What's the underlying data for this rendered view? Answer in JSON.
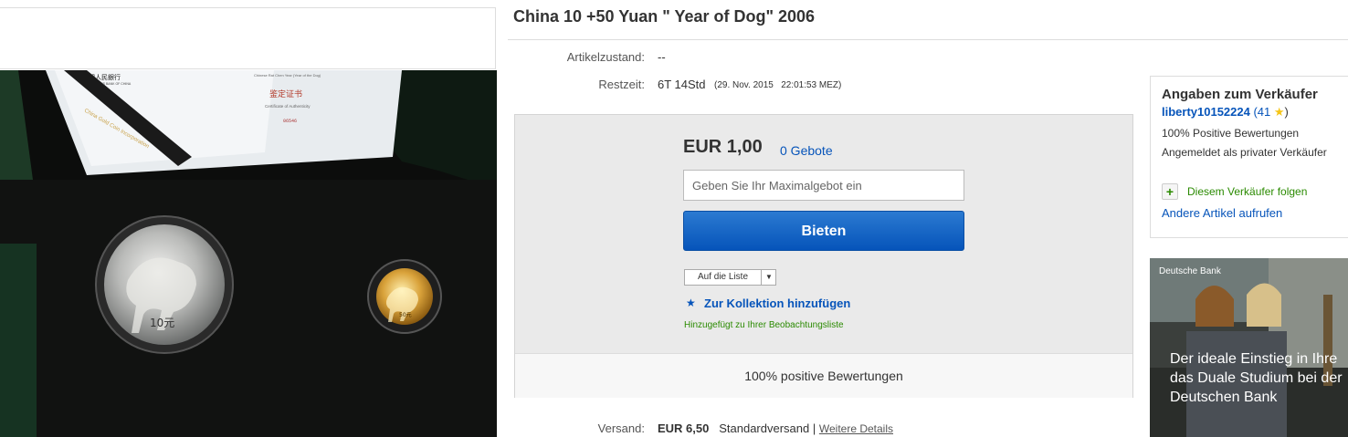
{
  "listing": {
    "title": "China 10 +50 Yuan \" Year of Dog\" 2006",
    "condition_label": "Artikelzustand:",
    "condition_value": "--",
    "time_label": "Restzeit:",
    "time_value": "6T 14Std",
    "time_end": "(29. Nov. 2015   22:01:53 MEZ)"
  },
  "photo": {
    "certificate_bank": "中國人民銀行",
    "certificate_bank_en": "THE PEOPLE'S BANK OF CHINA",
    "certificate_title": "鉴定证书",
    "certificate_subtitle": "Certificate of Authenticity",
    "certificate_header": "Chinese Rat Chen Year (Year of the Dog)",
    "certificate_number": "06546",
    "ribbon_text": "China Gold Coin Incorporation",
    "silver_coin_value": "10元",
    "gold_coin_value": "50元"
  },
  "bid": {
    "price": "EUR 1,00",
    "bids": "0 Gebote",
    "input_placeholder": "Geben Sie Ihr Maximalgebot ein",
    "bid_button": "Bieten",
    "watch_select": "Auf die Liste",
    "collection_link": "Zur Kollektion hinzufügen",
    "watch_note": "Hinzugefügt zu Ihrer Beobachtungsliste",
    "footer": "100% positive Bewertungen"
  },
  "seller": {
    "title": "Angaben zum Verkäufer",
    "name": "liberty10152224",
    "score_open": " (41 ",
    "score_close": ")",
    "positive": "100% Positive Bewertungen",
    "registered": "Angemeldet als privater Verkäufer",
    "follow": "Diesem Verkäufer folgen",
    "other_items": "Andere Artikel aufrufen"
  },
  "ad": {
    "brand": "Deutsche Bank",
    "line1": "Der ideale Einstieg in Ihre",
    "line2": "das Duale Studium bei der",
    "line3": "Deutschen Bank"
  },
  "shipping": {
    "label": "Versand:",
    "price": "EUR 6,50",
    "method": "Standardversand",
    "separator": "|",
    "details_link": "Weitere Details"
  },
  "colors": {
    "link": "#0654ba",
    "button": "#0654ba",
    "positive": "#2a8a00",
    "star": "#f5c518"
  }
}
